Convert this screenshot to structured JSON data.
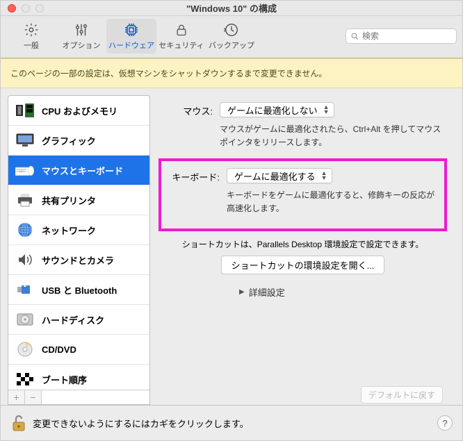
{
  "window": {
    "title": "\"Windows 10\" の構成"
  },
  "toolbar": {
    "items": [
      {
        "label": "一般"
      },
      {
        "label": "オプション"
      },
      {
        "label": "ハードウェア"
      },
      {
        "label": "セキュリティ"
      },
      {
        "label": "バックアップ"
      }
    ],
    "search_placeholder": "検索"
  },
  "warning": "このページの一部の設定は、仮想マシンをシャットダウンするまで変更できません。",
  "sidebar": {
    "items": [
      {
        "label": "CPU およびメモリ"
      },
      {
        "label": "グラフィック"
      },
      {
        "label": "マウスとキーボード"
      },
      {
        "label": "共有プリンタ"
      },
      {
        "label": "ネットワーク"
      },
      {
        "label": "サウンドとカメラ"
      },
      {
        "label": "USB と Bluetooth"
      },
      {
        "label": "ハードディスク"
      },
      {
        "label": "CD/DVD"
      },
      {
        "label": "ブート順序"
      }
    ],
    "add": "+",
    "remove": "−"
  },
  "content": {
    "mouse_label": "マウス:",
    "mouse_value": "ゲームに最適化しない",
    "mouse_hint": "マウスがゲームに最適化されたら、Ctrl+Alt を押してマウスポインタをリリースします。",
    "keyboard_label": "キーボード:",
    "keyboard_value": "ゲームに最適化する",
    "keyboard_hint": "キーボードをゲームに最適化すると、修飾キーの反応が高速化します。",
    "shortcut_text": "ショートカットは、Parallels Desktop 環境設定で設定できます。",
    "shortcut_button": "ショートカットの環境設定を開く...",
    "advanced": "詳細設定",
    "default_button": "デフォルトに戻す"
  },
  "footer": {
    "lock_text": "変更できないようにするにはカギをクリックします。"
  }
}
